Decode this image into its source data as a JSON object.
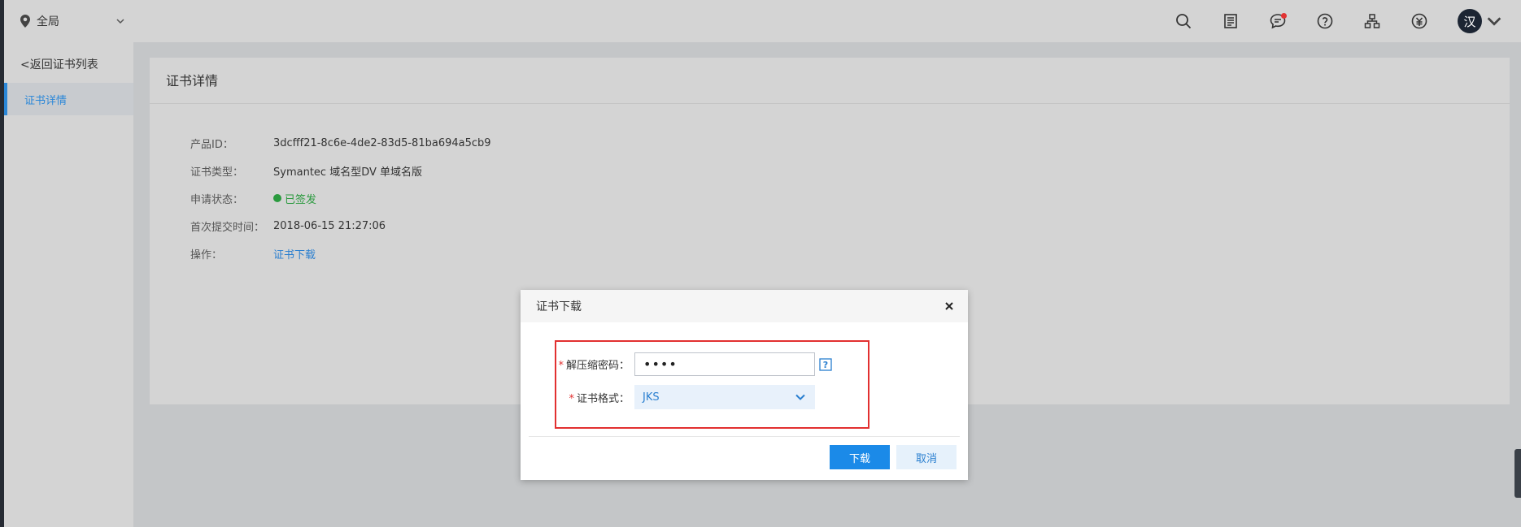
{
  "topbar": {
    "region_label": "全局",
    "avatar_text": "汉",
    "icons": [
      "search-icon",
      "order-list-icon",
      "message-icon",
      "help-icon",
      "network-icon",
      "billing-icon"
    ]
  },
  "sidebar": {
    "back_label": "<返回证书列表",
    "items": [
      {
        "label": "证书详情",
        "active": true
      }
    ]
  },
  "main": {
    "title": "证书详情",
    "fields": [
      {
        "label": "产品ID：",
        "value": "3dcfff21-8c6e-4de2-83d5-81ba694a5cb9"
      },
      {
        "label": "证书类型：",
        "value": "Symantec 域名型DV 单域名版"
      },
      {
        "label": "申请状态：",
        "value": "已签发"
      },
      {
        "label": "首次提交时间：",
        "value": "2018-06-15 21:27:06"
      },
      {
        "label": "操作：",
        "value": "证书下载"
      }
    ]
  },
  "dialog": {
    "title": "证书下载",
    "password_label": "解压缩密码：",
    "password_value": "••••",
    "format_label": "证书格式：",
    "format_value": "JKS",
    "download_label": "下载",
    "cancel_label": "取消",
    "required_mark": "*",
    "help_glyph": "?"
  },
  "colors": {
    "accent": "#1b8ae8",
    "success": "#2a9a3e",
    "highlight": "#e23030",
    "sidebar_dark": "#262b33"
  }
}
